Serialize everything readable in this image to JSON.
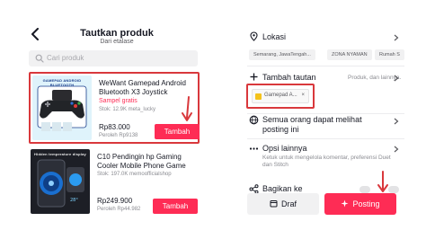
{
  "left": {
    "title": "Tautkan produk",
    "subtitle": "Dari etalase",
    "search_placeholder": "Cari produk",
    "products": [
      {
        "title": "WeWant Gamepad Android Bluetooth X3 Joystick Wireless...",
        "badge": "Sampel gratis",
        "meta": "Stok: 12.9K   meta_lucky",
        "price": "Rp83.000",
        "earn": "Peroleh Rp9138",
        "add_label": "Tambah",
        "image_caption": "GAMEPAD ANDROID BLUETOOTH"
      },
      {
        "title": "C10 Pendingin hp Gaming Cooler Mobile Phone Game Ra...",
        "meta": "Stok: 197.0K   memoofficialshop",
        "price": "Rp249.900",
        "earn": "Peroleh Rp44.982",
        "add_label": "Tambah",
        "image_caption": "Hidden temperature display"
      }
    ]
  },
  "right": {
    "location": {
      "label": "Lokasi",
      "pills": [
        "Semarang, JawaTengah...",
        "ZONA NYAMAN",
        "Rumah S"
      ]
    },
    "add_link": {
      "label": "Tambah tautan",
      "sub": "Produk, dan lainnya.",
      "chip": "Gamepad A...",
      "chip_close": "×"
    },
    "visibility": {
      "label": "Semua orang dapat melihat posting ini"
    },
    "more_options": {
      "label": "Opsi lainnya",
      "sub": "Ketuk untuk mengelola komentar, preferensi Duet dan Stitch"
    },
    "share": {
      "label": "Bagikan ke"
    },
    "draft_label": "Draf",
    "post_label": "Posting"
  },
  "colors": {
    "accent": "#fe2c55",
    "highlight": "#d9383c"
  },
  "icons": [
    "back-arrow-icon",
    "search-icon",
    "location-pin-icon",
    "link-plus-icon",
    "globe-icon",
    "more-dots-icon",
    "share-icon",
    "chevron-right-icon",
    "draft-icon",
    "sparkle-post-icon"
  ]
}
